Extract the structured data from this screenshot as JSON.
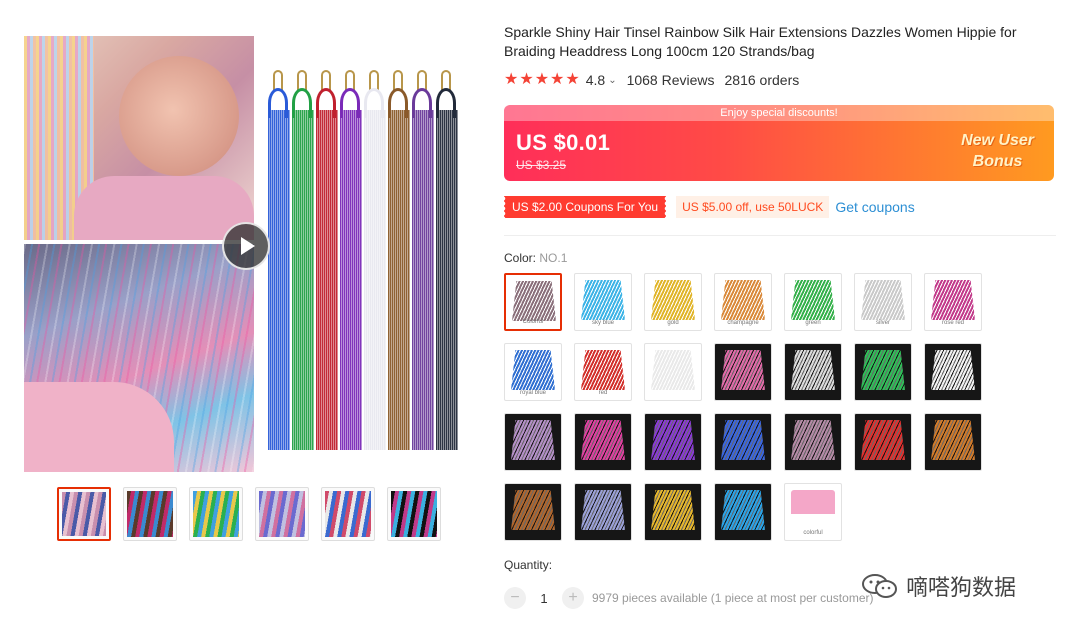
{
  "product": {
    "title": "Sparkle Shiny Hair Tinsel Rainbow Silk Hair Extensions Dazzles Women Hippie for Braiding Headdress Long 100cm 120 Strands/bag",
    "rating": "4.8",
    "reviews": "1068 Reviews",
    "orders": "2816 orders",
    "star_count": 5
  },
  "price": {
    "promo_strip": "Enjoy special discounts!",
    "current": "US $0.01",
    "original": "US $3.25",
    "bonus_line1": "New User",
    "bonus_line2": "Bonus"
  },
  "coupons": {
    "primary": "US $2.00 Coupons For You",
    "secondary": "US $5.00 off, use 50LUCK",
    "link": "Get coupons"
  },
  "color": {
    "label": "Color:",
    "selected": "NO.1",
    "swatches": [
      {
        "name": "colorful",
        "caption": "Colorful",
        "color": "#8a6f7a",
        "dark": false
      },
      {
        "name": "sky-blue",
        "caption": "sky blue",
        "color": "#3bb3e6",
        "dark": false
      },
      {
        "name": "gold",
        "caption": "gold",
        "color": "#e0b428",
        "dark": false
      },
      {
        "name": "champagne",
        "caption": "champagne",
        "color": "#d9893a",
        "dark": false
      },
      {
        "name": "green",
        "caption": "green",
        "color": "#34b04a",
        "dark": false
      },
      {
        "name": "silver",
        "caption": "silver",
        "color": "#c9c9c9",
        "dark": false
      },
      {
        "name": "rose-red",
        "caption": "rose red",
        "color": "#c23a8a",
        "dark": false
      },
      {
        "name": "royal-blue",
        "caption": "royal blue",
        "color": "#2f6fd1",
        "dark": false
      },
      {
        "name": "red",
        "caption": "red",
        "color": "#d2302b",
        "dark": false
      },
      {
        "name": "white",
        "caption": "",
        "color": "#e9e9e9",
        "dark": false
      },
      {
        "name": "pink-dark",
        "caption": "",
        "color": "#e26aa8",
        "dark": true
      },
      {
        "name": "silver-dark",
        "caption": "",
        "color": "#dcdcdc",
        "dark": true
      },
      {
        "name": "green-dark",
        "caption": "",
        "color": "#2fbf58",
        "dark": true
      },
      {
        "name": "white-dark",
        "caption": "",
        "color": "#f2f2f2",
        "dark": true
      },
      {
        "name": "holo-dark",
        "caption": "",
        "color": "#b48fc7",
        "dark": true
      },
      {
        "name": "magenta-dark",
        "caption": "",
        "color": "#e03fa0",
        "dark": true
      },
      {
        "name": "purple-dark",
        "caption": "",
        "color": "#8a3ad6",
        "dark": true
      },
      {
        "name": "blue-dark",
        "caption": "",
        "color": "#3a66e0",
        "dark": true
      },
      {
        "name": "mauve-dark",
        "caption": "",
        "color": "#b58aa6",
        "dark": true
      },
      {
        "name": "red-dark",
        "caption": "",
        "color": "#e0302e",
        "dark": true
      },
      {
        "name": "copper-dark",
        "caption": "",
        "color": "#d17a2a",
        "dark": true
      },
      {
        "name": "bronze-dark",
        "caption": "",
        "color": "#b0662d",
        "dark": true
      },
      {
        "name": "lavender-dark",
        "caption": "",
        "color": "#9aa0d8",
        "dark": true
      },
      {
        "name": "gold-dark",
        "caption": "",
        "color": "#e6b62c",
        "dark": true
      },
      {
        "name": "cyan-dark",
        "caption": "",
        "color": "#2aa3e8",
        "dark": true
      },
      {
        "name": "sample-card",
        "caption": "colorful",
        "color": "#f4a7c8",
        "dark": false
      }
    ]
  },
  "quantity": {
    "label": "Quantity:",
    "value": "1",
    "minus": "−",
    "plus": "+",
    "available": "9979 pieces available (1 piece at most per customer)"
  },
  "gallery": {
    "strand_colors": [
      "#2a5bd8",
      "#22a045",
      "#c0202e",
      "#7a2ab8",
      "#e8e8f0",
      "#8a5a2a",
      "#6a3a9a",
      "#222a3a"
    ],
    "thumbs": [
      {
        "name": "thumb-1",
        "colors": [
          "#c98fae",
          "#4a5aa8",
          "#e8c0d0"
        ]
      },
      {
        "name": "thumb-2",
        "colors": [
          "#5a3a2a",
          "#c02a6a",
          "#3a8ad0"
        ]
      },
      {
        "name": "thumb-3",
        "colors": [
          "#40a0e0",
          "#e8c84a",
          "#2ab050"
        ]
      },
      {
        "name": "thumb-4",
        "colors": [
          "#6a6ad0",
          "#c0c0e0",
          "#d070a0"
        ]
      },
      {
        "name": "thumb-5",
        "colors": [
          "#d04a6a",
          "#e8e8e8",
          "#3a6ad0"
        ]
      },
      {
        "name": "thumb-6",
        "colors": [
          "#111111",
          "#c03a8a",
          "#3ab0e0"
        ]
      }
    ]
  },
  "watermark": {
    "text": "嘀嗒狗数据"
  }
}
